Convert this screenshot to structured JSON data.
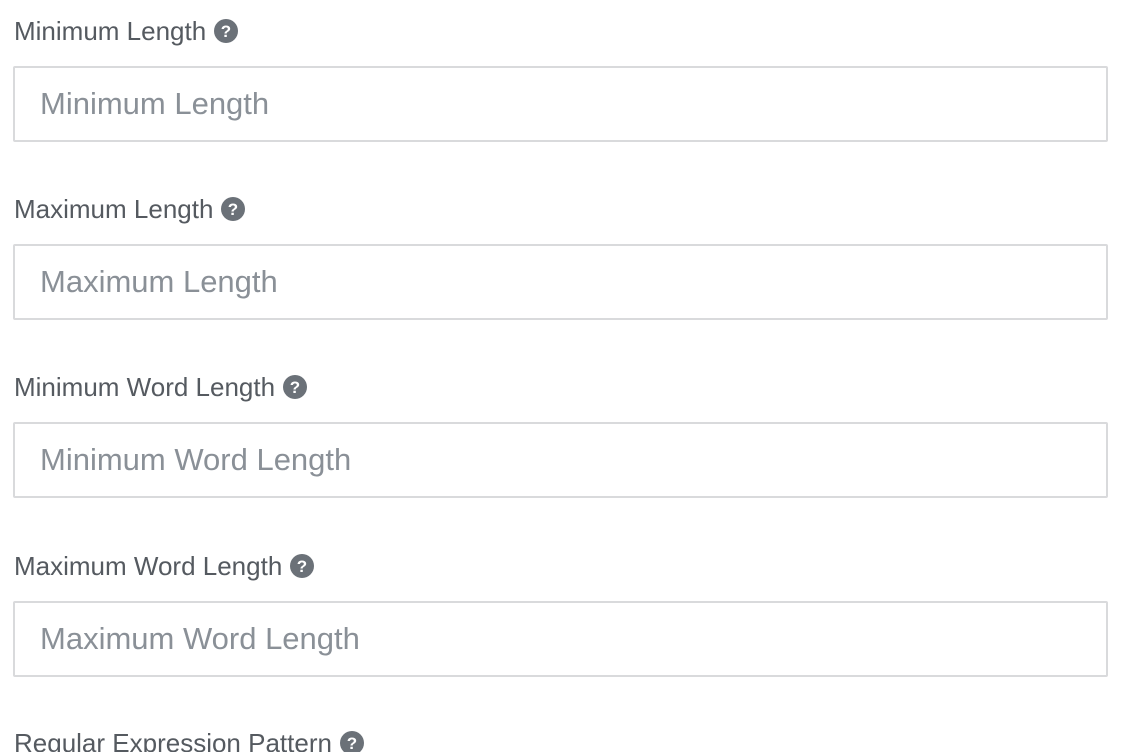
{
  "fields": [
    {
      "label": "Minimum Length",
      "placeholder": "Minimum Length",
      "value": ""
    },
    {
      "label": "Maximum Length",
      "placeholder": "Maximum Length",
      "value": ""
    },
    {
      "label": "Minimum Word Length",
      "placeholder": "Minimum Word Length",
      "value": ""
    },
    {
      "label": "Maximum Word Length",
      "placeholder": "Maximum Word Length",
      "value": ""
    },
    {
      "label": "Regular Expression Pattern"
    }
  ],
  "icons": {
    "help": "question-circle-icon"
  },
  "colors": {
    "label": "#555a60",
    "placeholder": "#8a9097",
    "border": "#d9dadc",
    "icon": "#6b7178"
  }
}
